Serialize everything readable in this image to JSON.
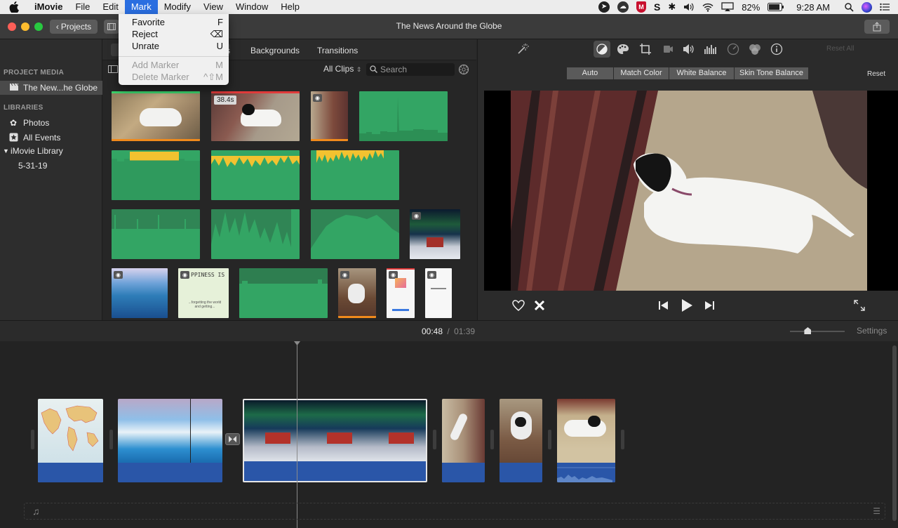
{
  "menubar": {
    "app_name": "iMovie",
    "items": [
      "File",
      "Edit",
      "Mark",
      "Modify",
      "View",
      "Window",
      "Help"
    ],
    "active_item": "Mark",
    "battery": "82%",
    "time": "9:28 AM"
  },
  "mark_menu": {
    "items": [
      {
        "label": "Favorite",
        "shortcut": "F",
        "enabled": true
      },
      {
        "label": "Reject",
        "shortcut": "⌫",
        "enabled": true
      },
      {
        "label": "Unrate",
        "shortcut": "U",
        "enabled": true
      },
      {
        "label": "Add Marker",
        "shortcut": "M",
        "enabled": false
      },
      {
        "label": "Delete Marker",
        "shortcut": "^⇧M",
        "enabled": false
      }
    ]
  },
  "titlebar": {
    "projects_label": "Projects",
    "title": "The News Around the Globe"
  },
  "sidebar": {
    "project_media_heading": "PROJECT MEDIA",
    "project_item": "The New...he Globe",
    "libraries_heading": "LIBRARIES",
    "photos": "Photos",
    "all_events": "All Events",
    "library": "iMovie Library",
    "event": "5-31-19"
  },
  "browser": {
    "tab_partial": "s",
    "tab_backgrounds": "Backgrounds",
    "tab_transitions": "Transitions",
    "filter": "All Clips",
    "search_placeholder": "Search",
    "clip_duration_badge": "38.4s",
    "happiness_text": "PPINESS IS",
    "happiness_caption": "...forgetting the world\nand getting..."
  },
  "viewer": {
    "adjust_buttons": [
      "Auto",
      "Match Color",
      "White Balance",
      "Skin Tone Balance"
    ],
    "reset_all": "Reset All",
    "reset": "Reset"
  },
  "timebar": {
    "current": "00:48",
    "separator": "/",
    "total": "01:39",
    "settings": "Settings",
    "zoom_level": 0.3
  },
  "colors": {
    "accent": "#2a6ee0",
    "audio_green": "#33a564",
    "audio_blue": "#2a56a8",
    "favorite_bar": "#3bd16b",
    "reject_bar": "#e03a3a",
    "used_bar": "#f08a1c"
  }
}
